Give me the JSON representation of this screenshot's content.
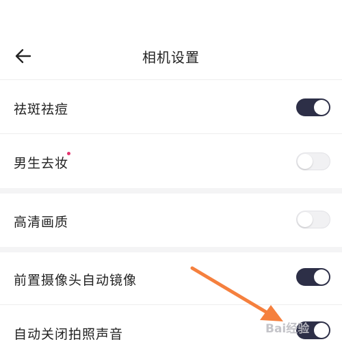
{
  "header": {
    "title": "相机设置",
    "back_icon": "arrow-left-icon"
  },
  "settings": [
    {
      "label": "祛斑祛痘",
      "enabled": true
    },
    {
      "label": "男生去妆",
      "enabled": false,
      "new_dot": true
    },
    {
      "label": "高清画质",
      "enabled": false
    },
    {
      "label": "前置摄像头自动镜像",
      "enabled": true
    },
    {
      "label": "自动关闭拍照声音",
      "enabled": true
    }
  ],
  "watermark": {
    "text": "Bai经验"
  },
  "colors": {
    "toggle_on": "#2d2f47",
    "toggle_off": "#f1f1f3",
    "section_gap": "#f4f4f5",
    "new_dot": "#e5356f",
    "annotation_arrow": "#f5803e"
  }
}
